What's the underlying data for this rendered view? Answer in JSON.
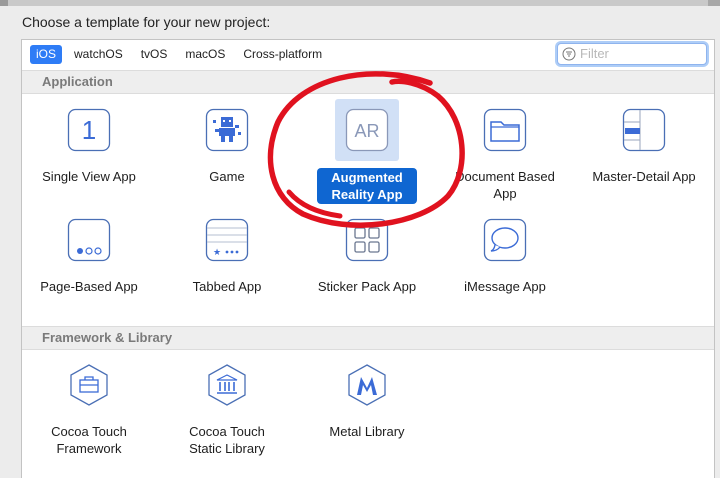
{
  "heading": "Choose a template for your new project:",
  "platform_tabs": [
    "iOS",
    "watchOS",
    "tvOS",
    "macOS",
    "Cross-platform"
  ],
  "selected_tab": "iOS",
  "filter": {
    "placeholder": "Filter",
    "value": ""
  },
  "sections": {
    "application": {
      "title": "Application",
      "templates": [
        {
          "label": "Single View App",
          "icon": "single-view-icon"
        },
        {
          "label": "Game",
          "icon": "game-icon"
        },
        {
          "label": "Augmented\nReality App",
          "icon": "ar-icon",
          "selected": true
        },
        {
          "label": "Document Based\nApp",
          "icon": "folder-icon"
        },
        {
          "label": "Master-Detail App",
          "icon": "master-detail-icon"
        },
        {
          "label": "Page-Based App",
          "icon": "page-based-icon"
        },
        {
          "label": "Tabbed App",
          "icon": "tabbed-icon"
        },
        {
          "label": "Sticker Pack App",
          "icon": "sticker-grid-icon"
        },
        {
          "label": "iMessage App",
          "icon": "speech-bubble-icon"
        }
      ]
    },
    "framework": {
      "title": "Framework & Library",
      "templates": [
        {
          "label": "Cocoa Touch\nFramework",
          "icon": "toolbox-icon"
        },
        {
          "label": "Cocoa Touch\nStatic Library",
          "icon": "library-building-icon"
        },
        {
          "label": "Metal Library",
          "icon": "metal-icon"
        }
      ]
    }
  },
  "colors": {
    "accent": "#2e7cf6",
    "selection_label": "#0f66d1",
    "annotation": "#e0121f",
    "icon_stroke": "#4a6fb5"
  }
}
